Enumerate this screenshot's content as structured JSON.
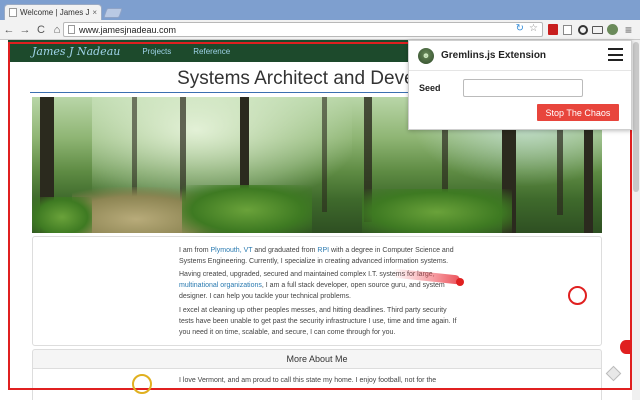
{
  "browser": {
    "tab_title": "Welcome | James J. N...",
    "tab_close": "×",
    "url": "www.jamesjnadeau.com",
    "nav_back": "←",
    "nav_forward": "→",
    "nav_reload": "C",
    "nav_home": "⌂",
    "menu": "≡"
  },
  "site": {
    "brand": "James J Nadeau",
    "nav": [
      "Projects",
      "Reference"
    ],
    "headline": "Systems Architect and Developer",
    "bio": {
      "p1_a": "I am from ",
      "p1_link1": "Plymouth, VT",
      "p1_b": " and graduated from ",
      "p1_link2": "RPI",
      "p1_c": " with a degree in Computer Science and Systems Engineering. Currently, I specialize in creating advanced information systems.",
      "p2_a": "Having created, upgraded, secured and maintained complex I.T. systems for large, ",
      "p2_link": "multinational organizations",
      "p2_b": ", I am a full stack developer, open source guru, and system designer. I can help you tackle your technical problems.",
      "p3": "I excel at cleaning up other peoples messes, and hitting deadlines. Third party security tests have been unable to get past the security infrastructure I use, time and time again. If you need it on time, scalable, and secure, I can come through for you."
    },
    "more_heading": "More About Me",
    "more_text": "I love Vermont, and am proud to call this state my home. I enjoy football, not for the"
  },
  "gremlins": {
    "title": "Gremlins.js Extension",
    "seed_label": "Seed",
    "seed_value": "",
    "seed_placeholder": "",
    "stop_label": "Stop The Chaos",
    "colors": {
      "attack": "#e02020",
      "stop_button": "#e8453c",
      "marker": "#e0b020"
    }
  },
  "icons": [
    "page-icon",
    "back-icon",
    "forward-icon",
    "reload-icon",
    "home-icon",
    "star-icon",
    "gremlin-logo-icon",
    "hamburger-icon"
  ]
}
